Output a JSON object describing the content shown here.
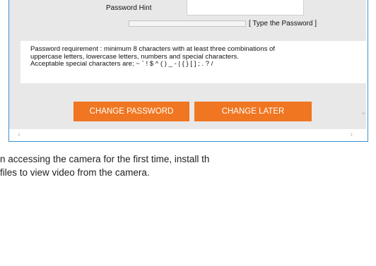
{
  "form": {
    "hint_label": "Password Hint",
    "hint_value": "",
    "strength_fraction": 0,
    "strength_text": "[ Type the Password ]"
  },
  "requirements": {
    "lines": [
      "Password requirement : minimum 8 characters with at least three combinations of",
      "uppercase letters, lowercase letters, numbers and special characters.",
      "Acceptable special characters are; ~ ` ! $ ^ ( ) _ - | { } [ ] ; . ? /"
    ]
  },
  "buttons": {
    "change_password": "CHANGE PASSWORD",
    "change_later": "CHANGE LATER"
  },
  "scroll_icons": {
    "down": "⌄",
    "left": "‹",
    "right": "›"
  },
  "instructions": {
    "line1": "n accessing the camera for the first time, install th",
    "line2": "files to view video from the camera."
  },
  "colors": {
    "accent_button": "#f07622",
    "frame_border": "#3f8fd2",
    "panel_bg": "#e8e8e8"
  }
}
